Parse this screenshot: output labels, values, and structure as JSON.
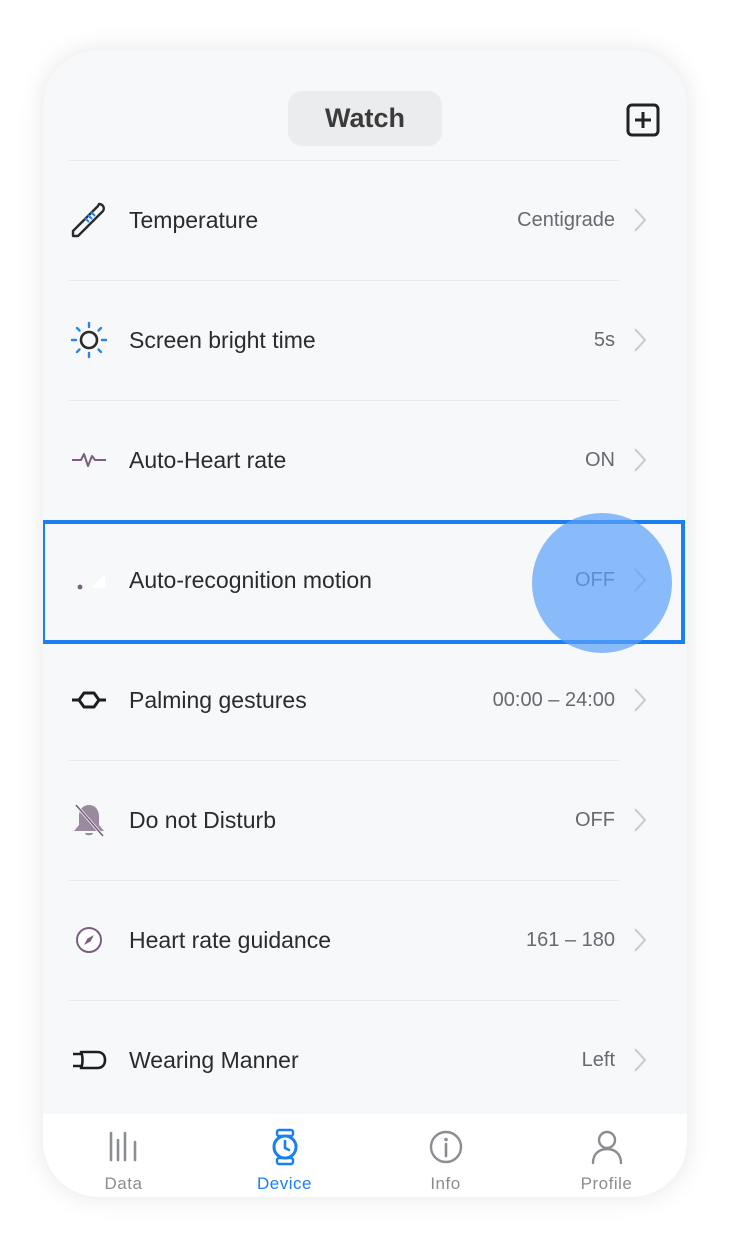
{
  "header": {
    "title": "Watch"
  },
  "settings": [
    {
      "label": "Temperature",
      "value": "Centigrade",
      "icon": "thermometer-icon"
    },
    {
      "label": "Screen bright time",
      "value": "5s",
      "icon": "sun-icon"
    },
    {
      "label": "Auto-Heart rate",
      "value": "ON",
      "icon": "heartbeat-icon"
    },
    {
      "label": "Auto-recognition motion",
      "value": "OFF",
      "icon": "motion-icon"
    },
    {
      "label": "Palming gestures",
      "value": "00:00 – 24:00",
      "icon": "palm-gesture-icon"
    },
    {
      "label": "Do not Disturb",
      "value": "OFF",
      "icon": "bell-off-icon"
    },
    {
      "label": "Heart rate guidance",
      "value": "161 – 180",
      "icon": "compass-icon"
    },
    {
      "label": "Wearing Manner",
      "value": "Left",
      "icon": "wrist-band-icon"
    }
  ],
  "tabs": [
    {
      "label": "Data",
      "icon": "data-bars-icon",
      "active": false
    },
    {
      "label": "Device",
      "icon": "watch-icon",
      "active": true
    },
    {
      "label": "Info",
      "icon": "info-icon",
      "active": false
    },
    {
      "label": "Profile",
      "icon": "person-icon",
      "active": false
    }
  ],
  "colors": {
    "accent": "#1a7ff0",
    "icon_purple": "#7a5f80",
    "sun_blue": "#2a83e8"
  }
}
